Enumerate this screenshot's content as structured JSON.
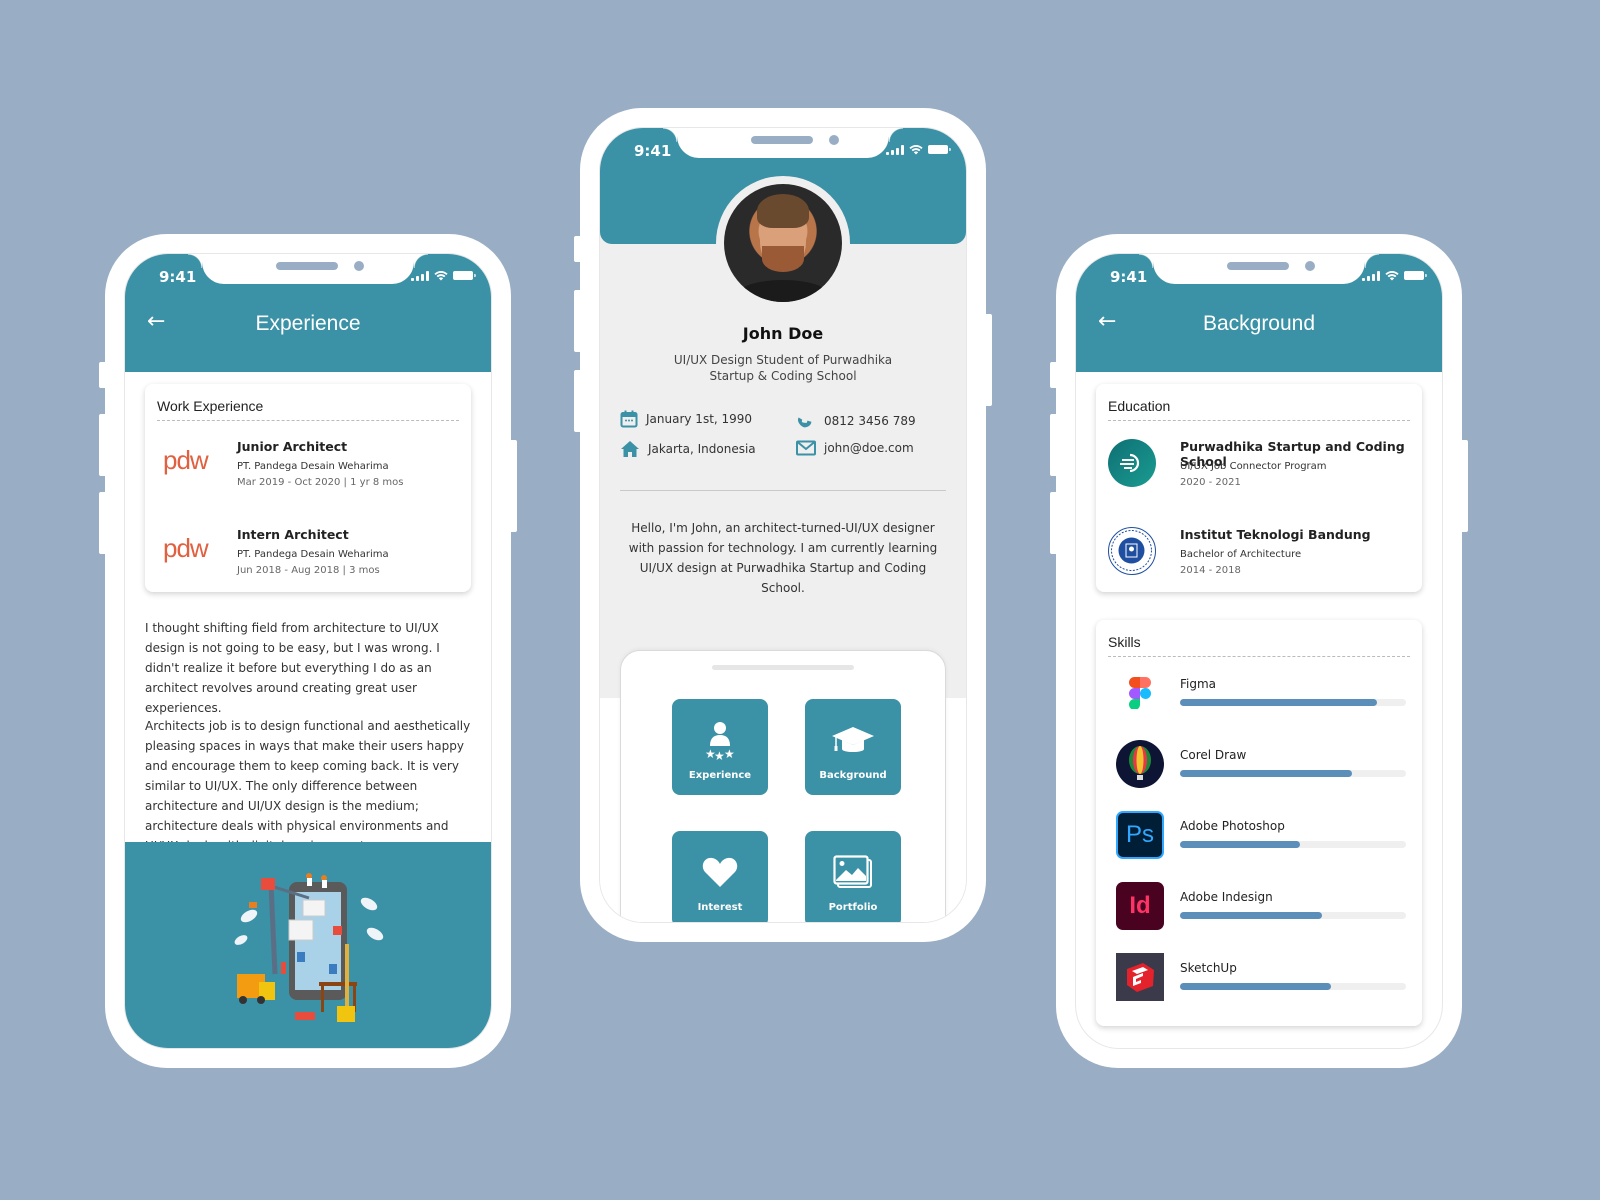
{
  "colors": {
    "background": "#99aec4",
    "primary": "#3b91a5",
    "skill_bar": "#5b8fba",
    "pdw_orange": "#e0603f"
  },
  "status_bar": {
    "time": "9:41"
  },
  "experience_screen": {
    "back_icon": "arrow-left-icon",
    "title": "Experience",
    "card_title": "Work Experience",
    "items": [
      {
        "logo_text": "pdw",
        "title": "Junior Architect",
        "company": "PT. Pandega Desain Weharima",
        "period": "Mar 2019 - Oct 2020 | 1 yr 8 mos"
      },
      {
        "logo_text": "pdw",
        "title": "Intern Architect",
        "company": "PT. Pandega Desain Weharima",
        "period": "Jun 2018 - Aug 2018 | 3 mos"
      }
    ],
    "paragraphs": [
      "I thought shifting field from architecture to UI/UX design is not going to be easy, but I was wrong. I didn't realize it before but everything I do as an architect revolves around creating great user experiences.",
      "Architects job is to design functional and aesthetically pleasing spaces in ways that make their users happy and encourage them to keep coming back. It is very similar to UI/UX. The only difference between architecture and UI/UX design is the medium; architecture deals with physical environments and UI/UX deals with digital environments."
    ],
    "illustration": "app-construction-illustration"
  },
  "profile_screen": {
    "name": "John Doe",
    "tagline": "UI/UX Design Student of Purwadhika Startup & Coding School",
    "contacts": {
      "birthday": {
        "icon": "calendar-icon",
        "value": "January 1st, 1990"
      },
      "phone": {
        "icon": "phone-icon",
        "value": "0812 3456 789"
      },
      "location": {
        "icon": "home-icon",
        "value": "Jakarta, Indonesia"
      },
      "email": {
        "icon": "mail-icon",
        "value": "john@doe.com"
      }
    },
    "bio": "Hello, I'm John, an architect-turned-UI/UX designer with passion for technology. I am currently learning UI/UX design at Purwadhika Startup and Coding School.",
    "menu": [
      {
        "label": "Experience",
        "icon": "user-stars-icon"
      },
      {
        "label": "Background",
        "icon": "graduation-cap-icon"
      },
      {
        "label": "Interest",
        "icon": "heart-icon"
      },
      {
        "label": "Portfolio",
        "icon": "image-gallery-icon"
      }
    ]
  },
  "background_screen": {
    "back_icon": "arrow-left-icon",
    "title": "Background",
    "education_title": "Education",
    "education": [
      {
        "school": "Purwadhika Startup and Coding School",
        "program": "UI/UX Job Connector Program",
        "years": "2020 - 2021"
      },
      {
        "school": "Institut Teknologi Bandung",
        "program": "Bachelor of Architecture",
        "years": "2014 - 2018"
      }
    ],
    "skills_title": "Skills",
    "skills": [
      {
        "name": "Figma",
        "level": 0.87
      },
      {
        "name": "Corel Draw",
        "level": 0.76
      },
      {
        "name": "Adobe Photoshop",
        "level": 0.53
      },
      {
        "name": "Adobe Indesign",
        "level": 0.63
      },
      {
        "name": "SketchUp",
        "level": 0.67
      }
    ]
  }
}
